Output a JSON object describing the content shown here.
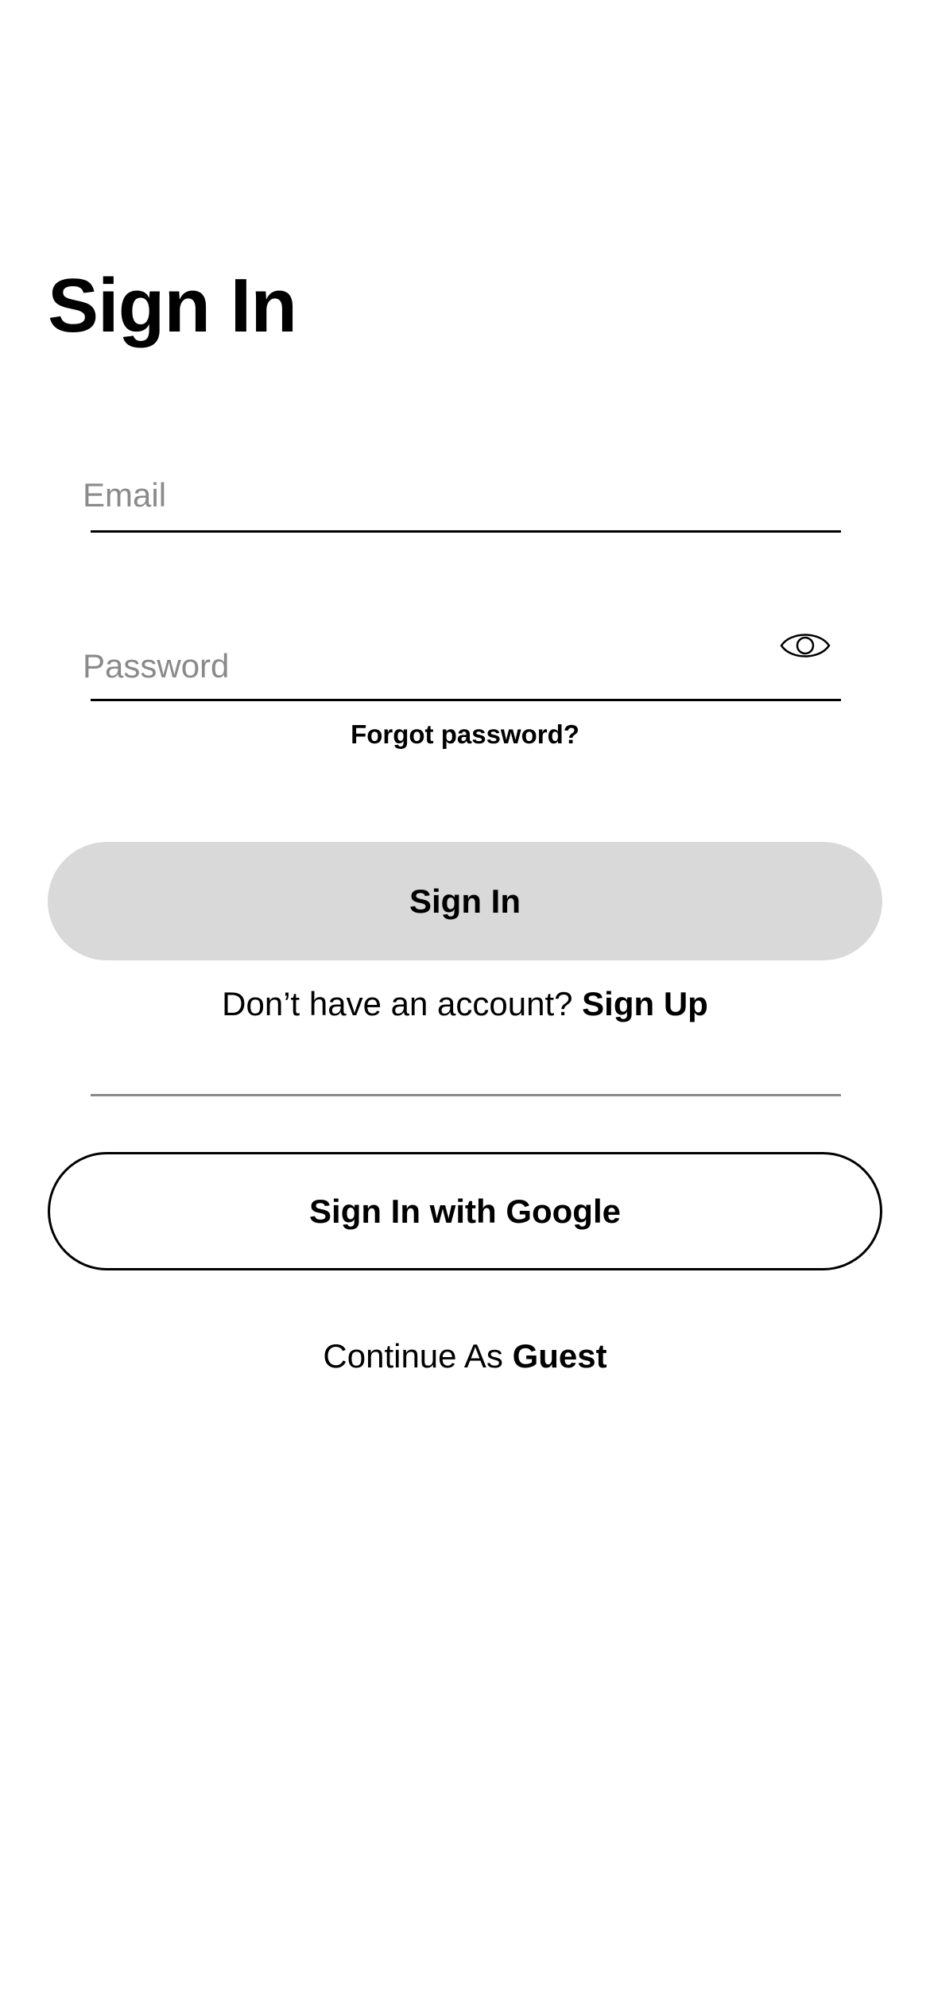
{
  "page": {
    "title": "Sign In"
  },
  "form": {
    "email_placeholder": "Email",
    "email_value": "",
    "password_placeholder": "Password",
    "password_value": "",
    "password_toggle_icon": "eye-icon",
    "forgot_password_label": "Forgot password?",
    "submit_label": "Sign In"
  },
  "signup": {
    "prompt": "Don’t have an account? ",
    "link_label": "Sign Up"
  },
  "social": {
    "google_label": "Sign In with Google"
  },
  "guest": {
    "prompt": "Continue As ",
    "link_label": "Guest"
  },
  "colors": {
    "background": "#ffffff",
    "text": "#000000",
    "placeholder": "#8a8a8a",
    "primary_button_bg": "#d9d9d9",
    "divider": "#8a8a8a"
  }
}
